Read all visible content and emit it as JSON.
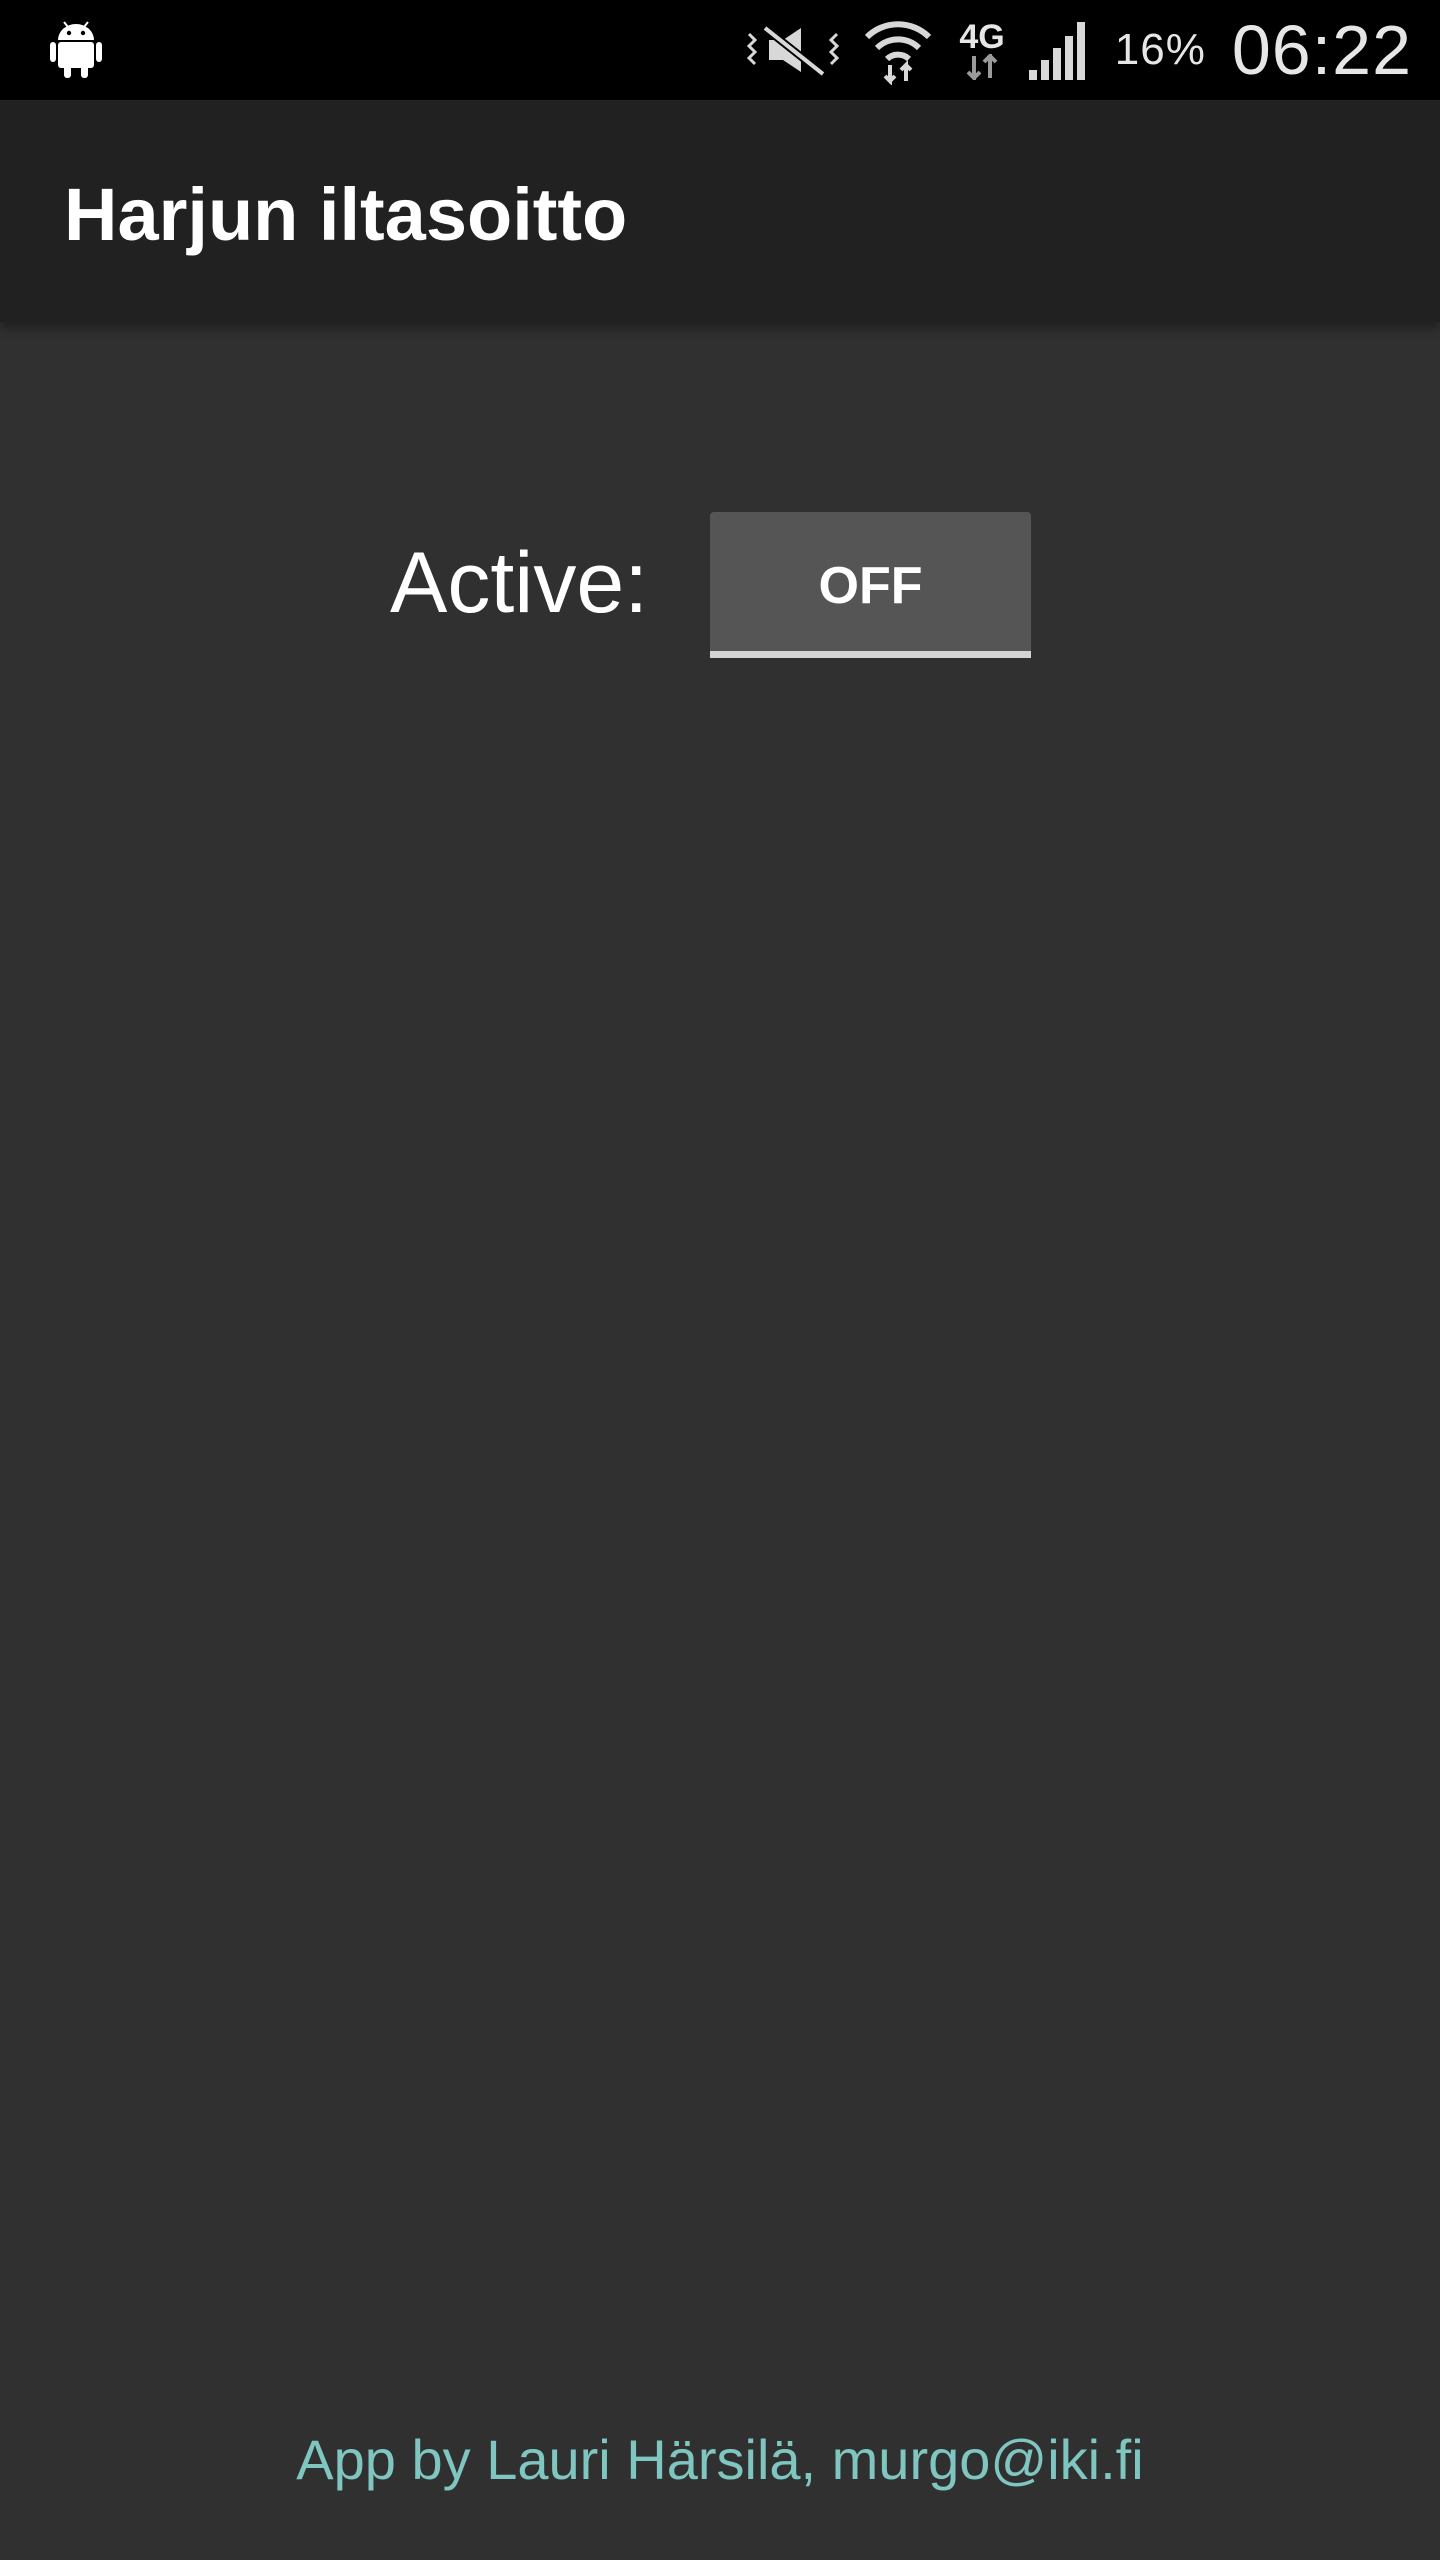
{
  "status_bar": {
    "icons": [
      "android-icon",
      "vibrate-mute-icon",
      "wifi-icon",
      "signal-icon"
    ],
    "network_type": "4G",
    "battery": "16%",
    "time": "06:22"
  },
  "action_bar": {
    "title": "Harjun iltasoitto"
  },
  "main": {
    "active_label": "Active:",
    "toggle": {
      "label": "OFF",
      "state": "off"
    }
  },
  "footer": {
    "credit": "App by Lauri Härsilä, murgo@iki.fi"
  },
  "colors": {
    "background": "#303030",
    "action_bar": "#212121",
    "status_bar": "#000000",
    "toggle_bg": "#555556",
    "footer_text": "#7fc6c0"
  }
}
